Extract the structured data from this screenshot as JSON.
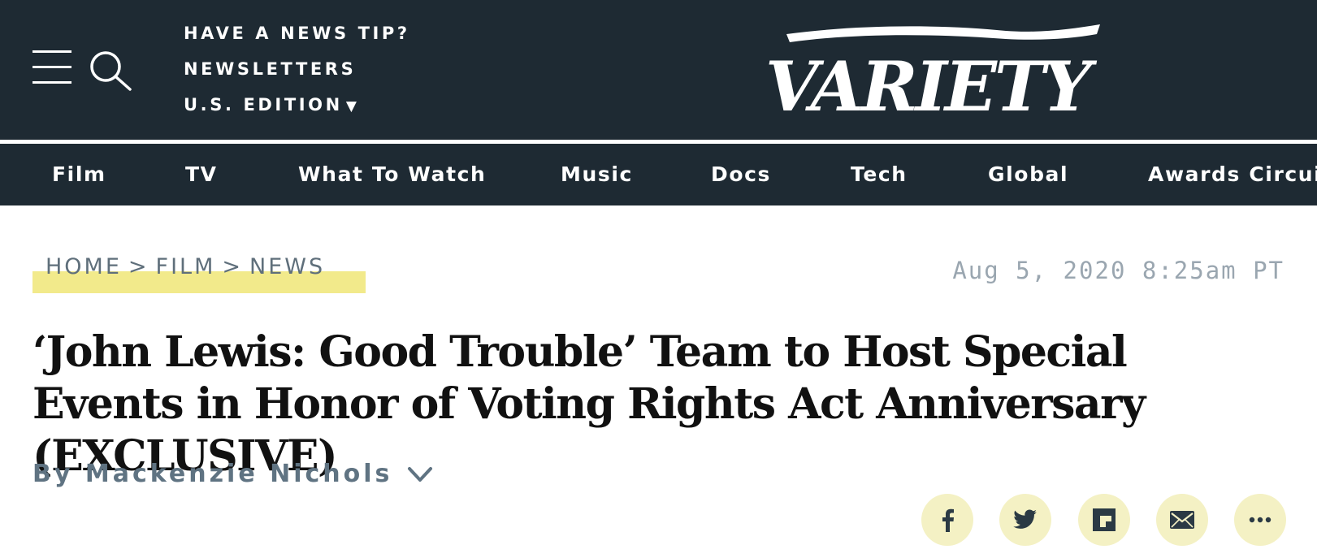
{
  "header": {
    "news_tip": "HAVE A NEWS TIP?",
    "newsletters": "NEWSLETTERS",
    "edition": "U.S. EDITION",
    "edition_caret": "▼",
    "logo": "VARIETY"
  },
  "nav": {
    "items": [
      "Film",
      "TV",
      "What To Watch",
      "Music",
      "Docs",
      "Tech",
      "Global",
      "Awards Circuit"
    ]
  },
  "breadcrumb": {
    "home": "HOME",
    "film": "FILM",
    "news": "NEWS",
    "separator": ">"
  },
  "article": {
    "timestamp": "Aug 5, 2020 8:25am PT",
    "headline": "‘John Lewis: Good Trouble’ Team to Host Special Events in Honor of Voting Rights Act Anniversary (EXCLUSIVE)",
    "byline": "By Mackenzie Nichols"
  },
  "share": {
    "icons": [
      "facebook-icon",
      "twitter-icon",
      "flipboard-icon",
      "email-icon",
      "more-icon"
    ]
  },
  "colors": {
    "masthead_bg": "#1e2a33",
    "breadcrumb_highlight": "#f2ea8b",
    "share_button_bg": "#f4f1c4",
    "byline": "#5f7382"
  }
}
